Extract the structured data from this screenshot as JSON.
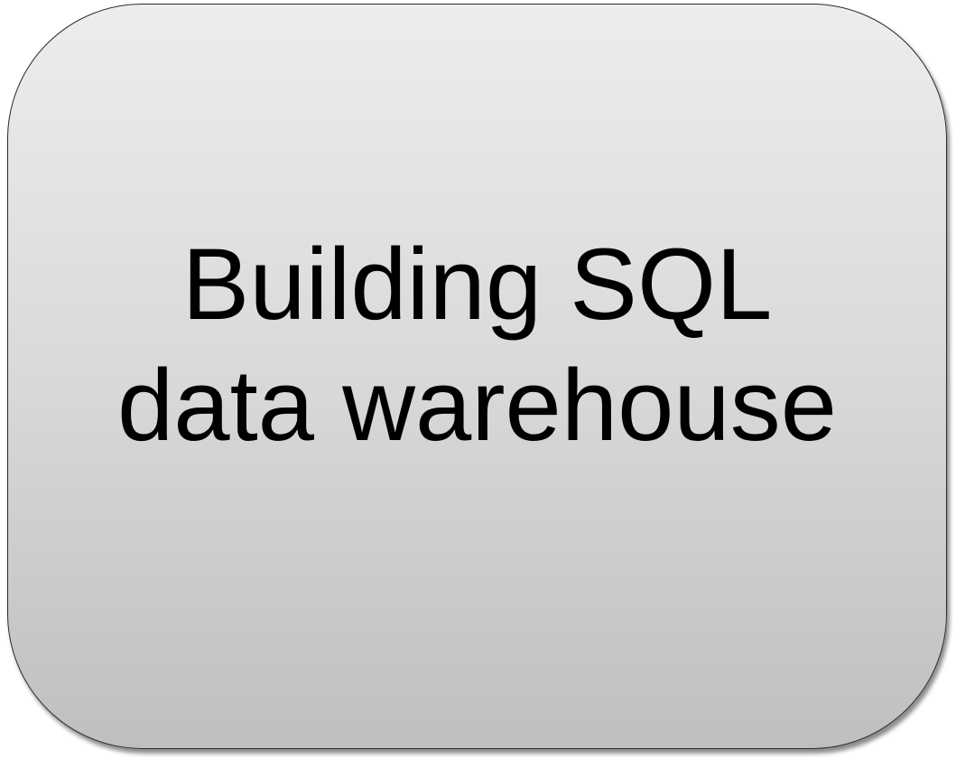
{
  "box": {
    "lines": [
      "Building SQL",
      "data warehouse"
    ],
    "text_color": "#000000",
    "border_color": "#2b2b2b",
    "fill_gradient": [
      "#ededed",
      "#bfbfbf"
    ]
  }
}
